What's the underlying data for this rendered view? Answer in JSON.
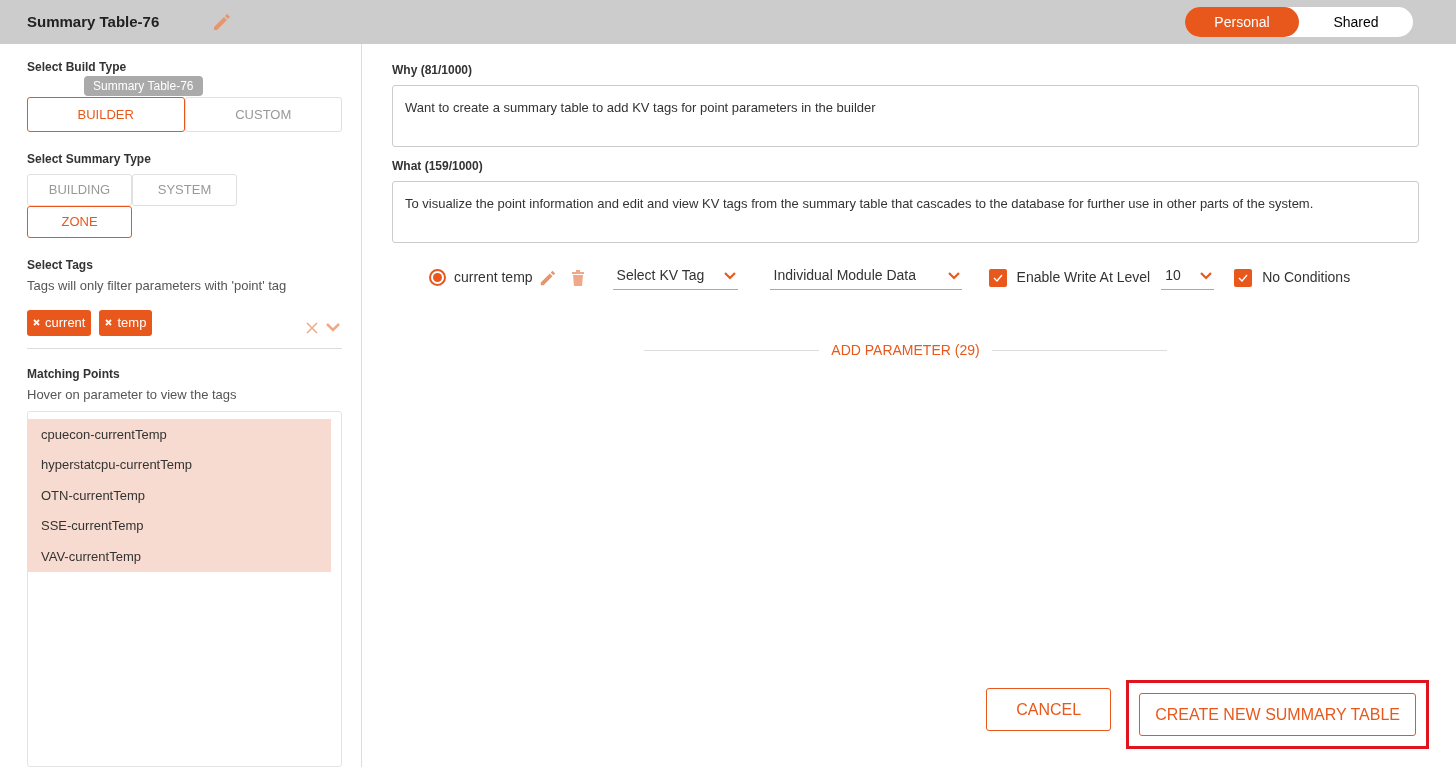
{
  "header": {
    "title": "Summary Table-76",
    "tooltip": "Summary Table-76",
    "sharing": [
      {
        "label": "Personal",
        "selected": true
      },
      {
        "label": "Shared",
        "selected": false
      }
    ]
  },
  "build_type": {
    "label": "Select Build Type",
    "options": [
      {
        "label": "BUILDER",
        "selected": true
      },
      {
        "label": "CUSTOM",
        "selected": false
      }
    ]
  },
  "summary_type": {
    "label": "Select Summary Type",
    "options": [
      {
        "label": "BUILDING",
        "selected": false
      },
      {
        "label": "SYSTEM",
        "selected": false
      },
      {
        "label": "ZONE",
        "selected": true
      }
    ]
  },
  "tags": {
    "label": "Select Tags",
    "hint": "Tags will only filter parameters with 'point' tag",
    "chips": [
      "current",
      "temp"
    ]
  },
  "matching_points": {
    "label": "Matching Points",
    "hint": "Hover on parameter to view the tags",
    "items": [
      {
        "label": "cpuecon-currentTemp",
        "selected": true
      },
      {
        "label": "hyperstatcpu-currentTemp",
        "selected": true
      },
      {
        "label": "OTN-currentTemp",
        "selected": true
      },
      {
        "label": "SSE-currentTemp",
        "selected": true
      },
      {
        "label": "VAV-currentTemp",
        "selected": true
      }
    ]
  },
  "why": {
    "label": "Why (81/1000)",
    "value": "Want to create a summary table to add KV tags for point parameters in the builder"
  },
  "what": {
    "label": "What (159/1000)",
    "value": "To visualize the point information and edit and view KV tags from the summary table that cascades to the database for further use in other parts of the system."
  },
  "parameters": [
    {
      "name": "current temp",
      "selected": true,
      "kv_tag": "Select KV Tag",
      "data_type": "Individual Module Data",
      "enable_write": {
        "label": "Enable Write At Level",
        "checked": true
      },
      "level_value": "10",
      "no_conditions": {
        "label": "No Conditions",
        "checked": true
      }
    }
  ],
  "add_parameter": "ADD PARAMETER (29)",
  "buttons": [
    {
      "label": "CANCEL",
      "highlighted": false
    },
    {
      "label": "CREATE NEW SUMMARY TABLE",
      "highlighted": true
    }
  ]
}
